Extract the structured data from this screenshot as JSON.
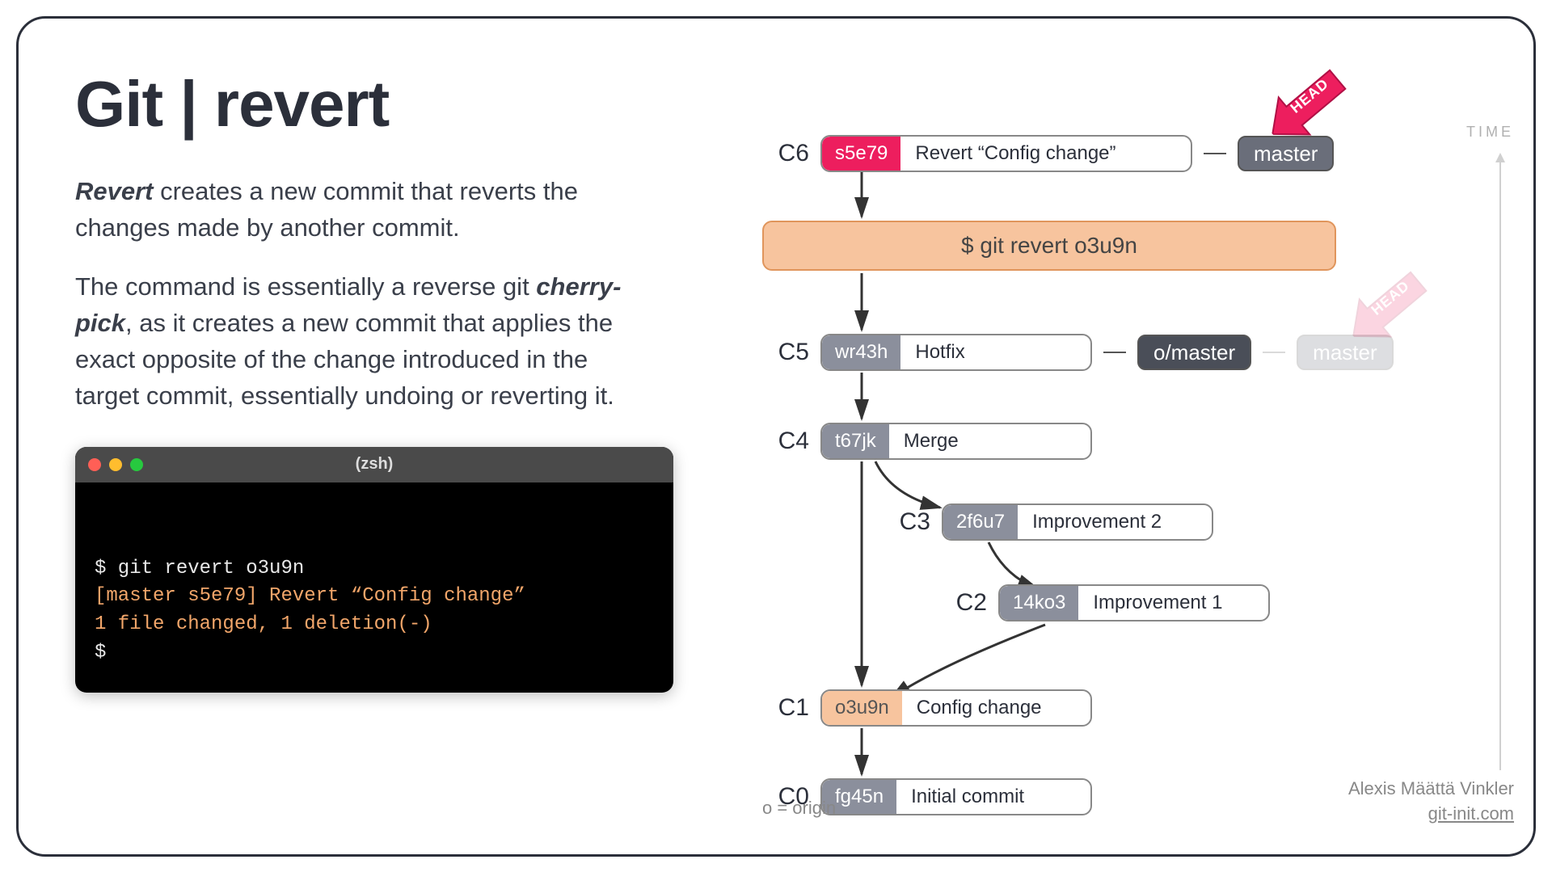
{
  "title": "Git | revert",
  "paragraphs": {
    "p1_strong": "Revert",
    "p1_rest": " creates a new commit that reverts the changes made by another commit.",
    "p2a": "The command is essentially a reverse git ",
    "p2_strong": "cherry-pick",
    "p2b": ", as it creates a new commit that applies the exact opposite of the change introduced in the target commit, essentially undoing or reverting it."
  },
  "terminal": {
    "shell": "(zsh)",
    "line1": "$ git revert o3u9n",
    "line2": "[master s5e79] Revert “Config change”",
    "line3": "1 file changed, 1 deletion(-)",
    "line4": "$"
  },
  "cmd_bar": "$ git revert o3u9n",
  "commits": {
    "c6": {
      "label": "C6",
      "hash": "s5e79",
      "msg": "Revert “Config change”"
    },
    "c5": {
      "label": "C5",
      "hash": "wr43h",
      "msg": "Hotfix"
    },
    "c4": {
      "label": "C4",
      "hash": "t67jk",
      "msg": "Merge"
    },
    "c3": {
      "label": "C3",
      "hash": "2f6u7",
      "msg": "Improvement 2"
    },
    "c2": {
      "label": "C2",
      "hash": "14ko3",
      "msg": "Improvement 1"
    },
    "c1": {
      "label": "C1",
      "hash": "o3u9n",
      "msg": "Config change"
    },
    "c0": {
      "label": "C0",
      "hash": "fg45n",
      "msg": "Initial commit"
    }
  },
  "branches": {
    "master": "master",
    "o_master": "o/master",
    "master_faded": "master"
  },
  "head": "HEAD",
  "time": "TIME",
  "legend": "o = origin",
  "credit_name": "Alexis Määttä Vinkler",
  "credit_link": "git-init.com"
}
